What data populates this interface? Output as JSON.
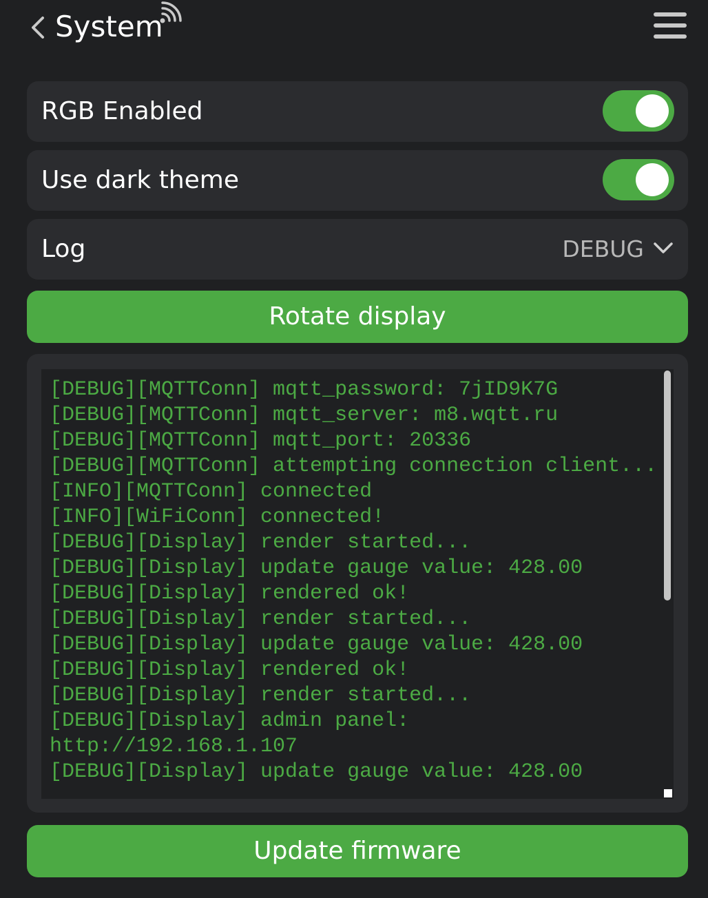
{
  "header": {
    "title": "System",
    "back_icon": "chevron-left-icon",
    "status_icon": "wifi-icon",
    "menu_icon": "hamburger-menu-icon"
  },
  "settings": {
    "rgb": {
      "label": "RGB Enabled",
      "enabled": true
    },
    "dark_theme": {
      "label": "Use dark theme",
      "enabled": true
    },
    "log": {
      "label": "Log",
      "value": "DEBUG"
    }
  },
  "buttons": {
    "rotate": "Rotate display",
    "update": "Update firmware"
  },
  "log_lines": [
    "[DEBUG][MQTTConn] mqtt_password: 7jID9K7G",
    "[DEBUG][MQTTConn] mqtt_server: m8.wqtt.ru",
    "[DEBUG][MQTTConn] mqtt_port: 20336",
    "[DEBUG][MQTTConn] attempting connection client...",
    "[INFO][MQTTConn] connected",
    "[INFO][WiFiConn] connected!",
    "[DEBUG][Display] render started...",
    "[DEBUG][Display] update gauge value: 428.00",
    "[DEBUG][Display] rendered ok!",
    "[DEBUG][Display] render started...",
    "[DEBUG][Display] update gauge value: 428.00",
    "[DEBUG][Display] rendered ok!",
    "[DEBUG][Display] render started...",
    "[DEBUG][Display] admin panel: http://192.168.1.107",
    "[DEBUG][Display] update gauge value: 428.00"
  ],
  "colors": {
    "accent": "#4caa44",
    "background": "#1f2022",
    "card": "#2b2c2f",
    "muted_text": "#b8b8b8"
  }
}
